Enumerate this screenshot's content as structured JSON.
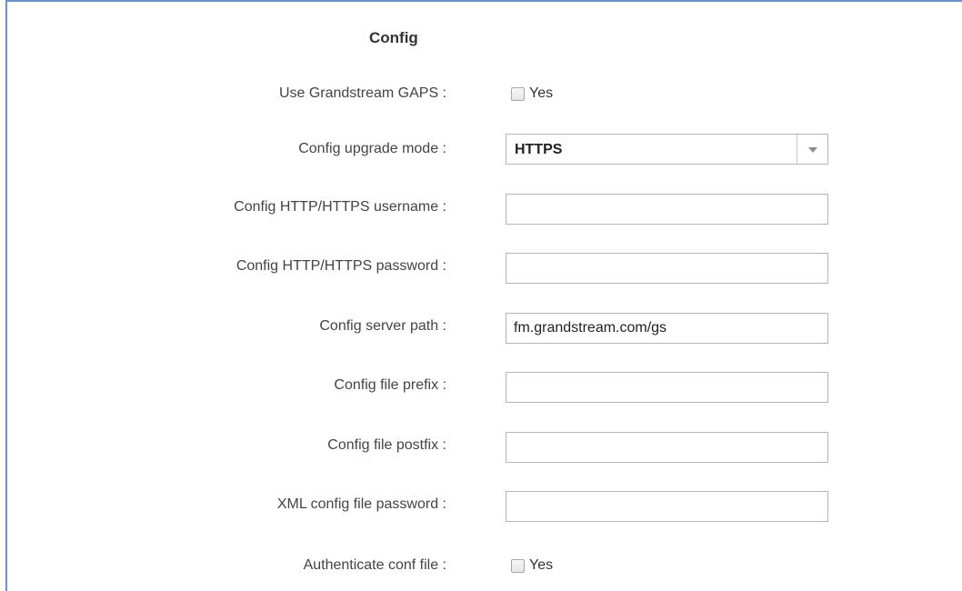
{
  "section": {
    "title": "Config"
  },
  "fields": {
    "gaps": {
      "label": "Use Grandstream GAPS :",
      "checkbox_label": "Yes",
      "checked": false
    },
    "upgrade_mode": {
      "label": "Config upgrade mode :",
      "value": "HTTPS"
    },
    "http_username": {
      "label": "Config HTTP/HTTPS username :",
      "value": ""
    },
    "http_password": {
      "label": "Config HTTP/HTTPS password :",
      "value": ""
    },
    "server_path": {
      "label": "Config server path :",
      "value": "fm.grandstream.com/gs"
    },
    "file_prefix": {
      "label": "Config file prefix :",
      "value": ""
    },
    "file_postfix": {
      "label": "Config file postfix :",
      "value": ""
    },
    "xml_password": {
      "label": "XML config file password :",
      "value": ""
    },
    "auth_conf": {
      "label": "Authenticate conf file :",
      "checkbox_label": "Yes",
      "checked": false
    }
  },
  "colors": {
    "frame_border": "#6f8fc7",
    "input_border": "#b5b5b5"
  },
  "icons": {
    "dropdown": "caret-down-icon"
  }
}
